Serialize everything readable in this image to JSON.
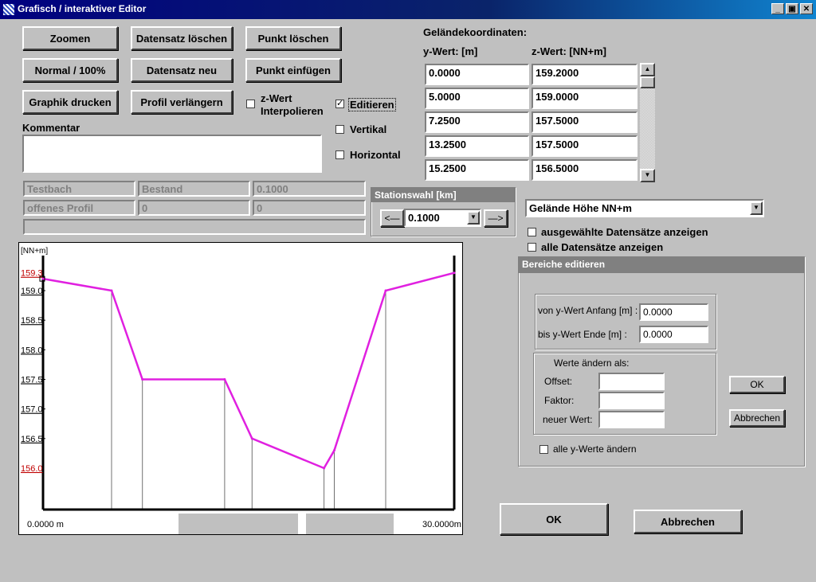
{
  "window": {
    "title": "Grafisch / interaktiver Editor",
    "minimize": "_",
    "maximize": "▣",
    "close": "✕"
  },
  "buttons": {
    "zoomen": "Zoomen",
    "datensatz_loeschen": "Datensatz löschen",
    "punkt_loeschen": "Punkt löschen",
    "normal": "Normal / 100%",
    "datensatz_neu": "Datensatz neu",
    "punkt_einfuegen": "Punkt einfügen",
    "graphik_drucken": "Graphik drucken",
    "profil_verlaengern": "Profil verlängern",
    "ok_main": "OK",
    "abbrechen_main": "Abbrechen"
  },
  "checks": {
    "z_interpolieren": {
      "label1": "z-Wert",
      "label2": "Interpolieren",
      "checked": ""
    },
    "editieren": {
      "label": "Editieren",
      "checked": "✓"
    },
    "vertikal": {
      "label": "Vertikal",
      "checked": ""
    },
    "horizontal": {
      "label": "Horizontal",
      "checked": ""
    },
    "ausgewaehlte": {
      "label": "ausgewählte Datensätze anzeigen",
      "checked": ""
    },
    "alle": {
      "label": "alle Datensätze anzeigen",
      "checked": ""
    },
    "alle_y": {
      "label": "alle y-Werte ändern",
      "checked": ""
    }
  },
  "kommentar": {
    "label": "Kommentar",
    "value": ""
  },
  "info": {
    "row1": [
      "Testbach",
      "Bestand",
      "0.1000"
    ],
    "row2": [
      "offenes Profil",
      "0",
      "0"
    ],
    "row3": ""
  },
  "station": {
    "title": "Stationswahl [km]",
    "prev": "<—",
    "next": "—>",
    "value": "0.1000",
    "arrow": "▼"
  },
  "coords": {
    "title": "Geländekoordinaten:",
    "y_header": "y-Wert:  [m]",
    "z_header": "z-Wert:  [NN+m]",
    "rows": [
      [
        "0.0000",
        "159.2000"
      ],
      [
        "5.0000",
        "159.0000"
      ],
      [
        "7.2500",
        "157.5000"
      ],
      [
        "13.2500",
        "157.5000"
      ],
      [
        "15.2500",
        "156.5000"
      ]
    ],
    "scroll_up": "▲",
    "scroll_down": "▼"
  },
  "gelaende_select": {
    "value": "Gelände Höhe NN+m",
    "arrow": "▼"
  },
  "bereiche": {
    "title": "Bereiche editieren",
    "von_label": "von y-Wert Anfang [m] :",
    "von_value": "0.0000",
    "bis_label": "bis  y-Wert Ende [m] :",
    "bis_value": "0.0000",
    "werte_title": "Werte ändern als:",
    "offset_label": "Offset:",
    "faktor_label": "Faktor:",
    "neuer_label": "neuer Wert:",
    "offset_value": "",
    "faktor_value": "",
    "neuer_value": "",
    "ok": "OK",
    "abbrechen": "Abbrechen"
  },
  "chart_data": {
    "type": "line",
    "ylabel": "[NN+m]",
    "y_ticks": [
      "159.0",
      "158.5",
      "158.0",
      "157.5",
      "157.0",
      "156.5"
    ],
    "y_marked": [
      "159.3",
      "156.0"
    ],
    "ylim": [
      155.3,
      159.7
    ],
    "xlim": [
      0,
      30
    ],
    "x_start_label": "0.0000 m",
    "x_end_label": "30.0000m",
    "line_color": "#e020e0",
    "marked_color": "#c00000",
    "x": [
      0,
      5,
      7.25,
      13.25,
      15.25,
      20.5,
      21.25,
      25,
      30
    ],
    "y": [
      159.2,
      159.0,
      157.5,
      157.5,
      156.5,
      156.0,
      156.3,
      159.0,
      159.3
    ]
  }
}
